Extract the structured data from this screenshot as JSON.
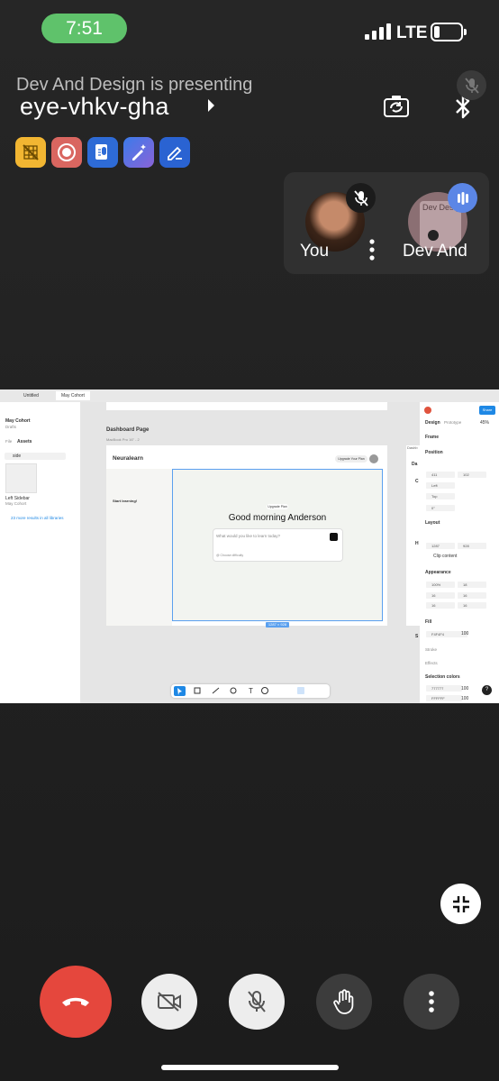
{
  "status_bar": {
    "time": "7:51",
    "network": "LTE"
  },
  "meeting": {
    "presenting_text": "Dev And Design is presenting",
    "code": "eye-vhkv-gha"
  },
  "participants": [
    {
      "name": "You"
    },
    {
      "name": "Dev And"
    }
  ],
  "dev_tile_text": "Dev Design",
  "figma": {
    "tabs": [
      "Untitled",
      "May Cohort"
    ],
    "left_panel": {
      "file_name": "May Cohort",
      "file_sub": "Drafts",
      "tab_file": "File",
      "tab_assets": "Assets",
      "search_value": "side",
      "asset_name": "Left Sidebar",
      "asset_sub": "May Cohort",
      "more_results": "23 more results in all libraries"
    },
    "canvas": {
      "page_title": "Dashboard Page",
      "device": "MacBook Pro 16\" - 2",
      "brand": "Neuralearn",
      "upgrade_btn": "Upgrade Your Plan",
      "sidebar_label": "Start learning!",
      "upgrade_small": "Upgrade Plan",
      "greeting": "Good morning Anderson",
      "prompt_placeholder": "What would you like to learn today?",
      "prompt_hint": "@ Choose difficulty",
      "size_label": "1287 × 928",
      "side_letters": [
        "Da",
        "C",
        "H",
        "S"
      ],
      "side_heading": "Dashb"
    },
    "right_panel": {
      "share": "Share",
      "tab_design": "Design",
      "tab_prototype": "Prototype",
      "zoom": "45%",
      "frame": "Frame",
      "position": "Position",
      "x": "411",
      "y": "102",
      "align_h": "Left",
      "align_v": "Top",
      "rotation": "0°",
      "layout": "Layout",
      "w": "1287",
      "h": "928",
      "clip": "Clip content",
      "appearance": "Appearance",
      "opacity": "100%",
      "radius": "18",
      "pad1": "16",
      "pad2": "16",
      "pad3": "16",
      "pad4": "16",
      "fill": "Fill",
      "fill_hex": "F4F4F4",
      "fill_pct": "100",
      "stroke": "Stroke",
      "effects": "Effects",
      "selection_colors": "Selection colors",
      "sel_hex1": "777777",
      "sel_pct1": "100",
      "sel_hex2": "FFFFFF",
      "sel_pct2": "100"
    }
  },
  "colors": {
    "end_call": "#e5473d",
    "status_pill": "#5fc26b",
    "figma_selection": "#5aa0ef"
  },
  "icons": {
    "header": [
      "camera-flip-icon",
      "bluetooth-icon",
      "mic-off-icon"
    ],
    "chips": [
      "grid-off-icon",
      "record-icon",
      "transcript-icon",
      "magic-pen-icon",
      "edit-icon"
    ],
    "controls": [
      "hang-up-icon",
      "video-off-icon",
      "mic-off-icon",
      "raise-hand-icon",
      "more-icon"
    ]
  }
}
